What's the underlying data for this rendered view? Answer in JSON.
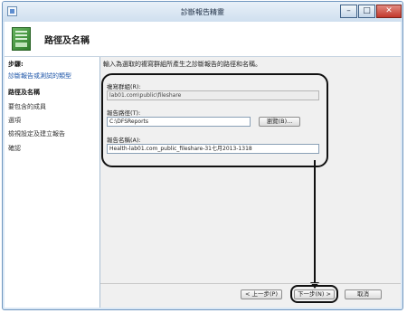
{
  "window": {
    "title": "診斷報告精靈"
  },
  "header": {
    "title": "路徑及名稱"
  },
  "sidebar": {
    "label": "步驟:",
    "steps": [
      {
        "label": "診斷報告或測試的類型"
      },
      {
        "label": "路徑及名稱"
      },
      {
        "label": "要包含的成員"
      },
      {
        "label": "選項"
      },
      {
        "label": "檢視設定及建立報告"
      },
      {
        "label": "確認"
      }
    ]
  },
  "main": {
    "intro": "輸入為選取的複寫群組所產生之診斷報告的路徑和名稱。",
    "replication_group": {
      "label": "複寫群組(R):",
      "value": "lab01.com\\public\\fileshare"
    },
    "report_path": {
      "label": "報告路徑(T):",
      "value": "C:\\DFSReports",
      "browse_label": "瀏覽(B)..."
    },
    "report_name": {
      "label": "報告名稱(A):",
      "value": "Health-lab01.com_public_fileshare-31七月2013-1318"
    }
  },
  "footer": {
    "back_label": "< 上一步(P)",
    "next_label": "下一步(N) >",
    "cancel_label": "取消"
  }
}
